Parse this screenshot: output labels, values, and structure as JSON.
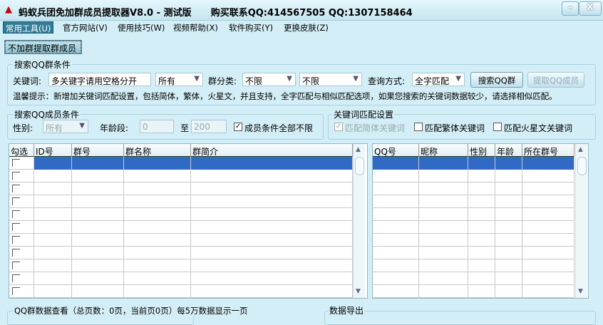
{
  "window": {
    "title": "蚂蚁兵团免加群成员提取器V8.0 - 测试版      购买联系QQ:414567505 QQ:1307158464",
    "minimize": "–",
    "close": "X"
  },
  "menu": [
    "常用工具(U)",
    "官方网站(V)",
    "使用技巧(W)",
    "视频帮助(X)",
    "软件购买(Y)",
    "更换皮肤(Z)"
  ],
  "toolbar": {
    "no_join_button": "不加群提取群成员"
  },
  "group_search": {
    "title": "搜索QQ群条件",
    "keyword_label": "关键词:",
    "keyword_value": "多关键字请用空格分开",
    "scope_value": "所有",
    "category_label": "群分类:",
    "category_value": "不限",
    "subcategory_value": "不限",
    "query_label": "查询方式:",
    "query_value": "全字匹配",
    "search_button": "搜索QQ群",
    "extract_button": "提取QQ成员",
    "hint": "温馨提示：新增加关键词匹配设置，包括简体，繁体，火星文，并且支持，全字匹配与相似匹配选项，如果您搜索的关键词数据较少，请选择相似匹配。"
  },
  "group_member": {
    "title": "搜索QQ成员条件",
    "gender_label": "性别:",
    "gender_value": "所有",
    "age_label": "年龄段:",
    "age_from": "0",
    "age_to_label": "至",
    "age_to": "200",
    "unlimited_label": "成员条件全部不限",
    "unlimited_checked": true
  },
  "group_match": {
    "title": "关键词匹配设置",
    "simplified": "匹配简体关键词",
    "simplified_checked": true,
    "traditional": "匹配繁体关键词",
    "traditional_checked": false,
    "martian": "匹配火星文关键词",
    "martian_checked": false
  },
  "left_table": {
    "columns": [
      "勾选",
      "ID号",
      "群号",
      "群名称",
      "群简介"
    ],
    "row_count": 11
  },
  "right_table": {
    "columns": [
      "QQ号",
      "昵称",
      "性别",
      "年龄",
      "所在群号"
    ],
    "row_count": 11
  },
  "bottom": {
    "group_view": "QQ群数据查看（总页数：0页，当前页0页）每5万数据显示一页",
    "export": "数据导出"
  }
}
